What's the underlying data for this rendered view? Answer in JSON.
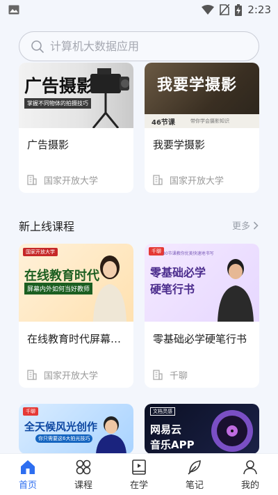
{
  "status": {
    "time": "2:23"
  },
  "search": {
    "placeholder": "计算机大数据应用"
  },
  "top_courses": [
    {
      "title": "广告摄影",
      "institution": "国家开放大学",
      "thumb_text": "广告摄影",
      "thumb_sub": "掌握不同物体的拍摄技巧"
    },
    {
      "title": "我要学摄影",
      "institution": "国家开放大学",
      "thumb_text": "我要学摄影",
      "thumb_badge": "46节课",
      "thumb_sub": "带你学会摄影知识"
    }
  ],
  "section": {
    "title": "新上线课程",
    "more": "更多"
  },
  "new_courses": [
    {
      "title": "在线教育时代屏幕…",
      "institution": "国家开放大学",
      "thumb_brand": "国家开放大学",
      "thumb_text": "在线教育时代",
      "thumb_sub": "屏幕内外如何当好教师"
    },
    {
      "title": "零基础必学硬笔行书",
      "institution": "千聊",
      "thumb_brand": "千聊",
      "thumb_text_1": "零基础必学",
      "thumb_text_2": "硬笔行书",
      "thumb_tag": "30节课教你优美快速地书写"
    }
  ],
  "more_courses": [
    {
      "thumb_brand": "千聊",
      "thumb_text": "全天候风光创作",
      "thumb_sub": "你只需要这6大拍光技巧"
    },
    {
      "thumb_brand": "文档灵感",
      "thumb_text_1": "网易云",
      "thumb_text_2": "音乐APP"
    }
  ],
  "tabs": [
    {
      "label": "首页",
      "icon": "home-icon",
      "active": true
    },
    {
      "label": "课程",
      "icon": "clover-icon",
      "active": false
    },
    {
      "label": "在学",
      "icon": "book-play-icon",
      "active": false
    },
    {
      "label": "笔记",
      "icon": "feather-icon",
      "active": false
    },
    {
      "label": "我的",
      "icon": "person-icon",
      "active": false
    }
  ],
  "colors": {
    "accent": "#2d6ef0",
    "background": "#f3f6fc"
  }
}
